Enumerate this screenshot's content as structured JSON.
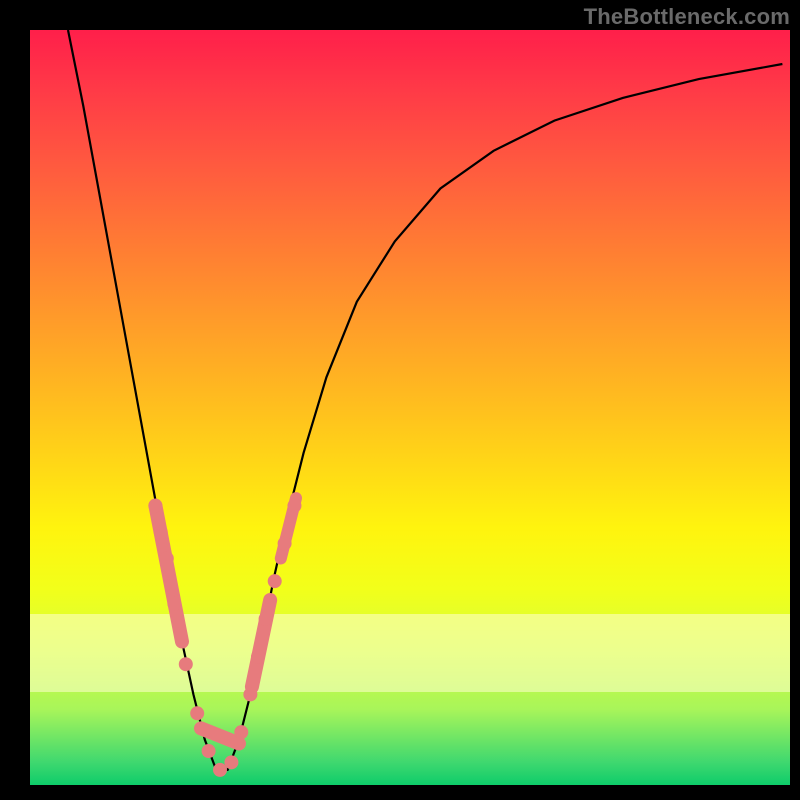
{
  "watermark": "TheBottleneck.com",
  "chart_data": {
    "type": "line",
    "title": "",
    "xlabel": "",
    "ylabel": "",
    "xlim": [
      0,
      1
    ],
    "ylim": [
      0,
      1
    ],
    "note_y_axis": "y=1 is top (red), y=0 is bottom (green). The line traces a V-shaped curve; reading y as 'bottleneck %', minimum near x≈0.25.",
    "series": [
      {
        "name": "bottleneck-curve",
        "color": "#000000",
        "x": [
          0.05,
          0.07,
          0.09,
          0.11,
          0.13,
          0.15,
          0.17,
          0.185,
          0.2,
          0.215,
          0.23,
          0.245,
          0.26,
          0.275,
          0.29,
          0.305,
          0.32,
          0.34,
          0.36,
          0.39,
          0.43,
          0.48,
          0.54,
          0.61,
          0.69,
          0.78,
          0.88,
          0.99
        ],
        "y": [
          1.0,
          0.9,
          0.79,
          0.68,
          0.57,
          0.46,
          0.35,
          0.27,
          0.19,
          0.12,
          0.06,
          0.02,
          0.02,
          0.06,
          0.12,
          0.19,
          0.27,
          0.36,
          0.44,
          0.54,
          0.64,
          0.72,
          0.79,
          0.84,
          0.88,
          0.91,
          0.935,
          0.955
        ]
      }
    ],
    "markers": {
      "name": "highlight-points",
      "color": "#e77b7d",
      "x": [
        0.165,
        0.172,
        0.18,
        0.19,
        0.205,
        0.22,
        0.235,
        0.25,
        0.265,
        0.278,
        0.29,
        0.3,
        0.31,
        0.322,
        0.335,
        0.348
      ],
      "y": [
        0.37,
        0.335,
        0.3,
        0.24,
        0.16,
        0.095,
        0.045,
        0.02,
        0.03,
        0.07,
        0.12,
        0.17,
        0.22,
        0.27,
        0.32,
        0.37
      ]
    },
    "segments": [
      {
        "name": "left-thick",
        "x1": 0.165,
        "y1": 0.37,
        "x2": 0.2,
        "y2": 0.19,
        "w": 14
      },
      {
        "name": "valley-thick",
        "x1": 0.225,
        "y1": 0.075,
        "x2": 0.275,
        "y2": 0.055,
        "w": 14
      },
      {
        "name": "right-thick-a",
        "x1": 0.292,
        "y1": 0.13,
        "x2": 0.316,
        "y2": 0.245,
        "w": 14
      },
      {
        "name": "right-thick-b",
        "x1": 0.33,
        "y1": 0.3,
        "x2": 0.35,
        "y2": 0.38,
        "w": 12
      }
    ],
    "pale_band": {
      "y_top": 0.226,
      "y_bottom": 0.122
    }
  }
}
